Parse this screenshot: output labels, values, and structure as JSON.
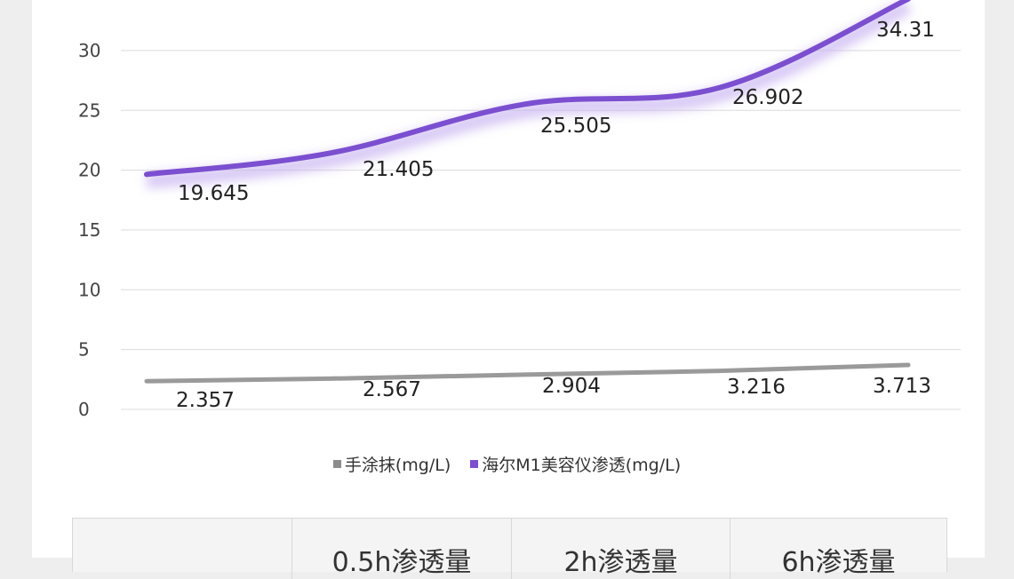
{
  "chart_data": {
    "type": "line",
    "categories": [
      "",
      "",
      "",
      "",
      ""
    ],
    "ylim": [
      0,
      35
    ],
    "yticks": [
      0,
      5,
      10,
      15,
      20,
      25,
      30
    ],
    "grid": true,
    "legend_position": "bottom",
    "series": [
      {
        "name": "手涂抹(mg/L)",
        "color": "#9a9a9a",
        "values": [
          2.357,
          2.567,
          2.904,
          3.216,
          3.713
        ],
        "labels": [
          "2.357",
          "2.567",
          "2.904",
          "3.216",
          "3.713"
        ]
      },
      {
        "name": "海尔M1美容仪渗透(mg/L)",
        "color": "#7b4fd0",
        "values": [
          19.645,
          21.405,
          25.505,
          26.902,
          34.31
        ],
        "labels": [
          "19.645",
          "21.405",
          "25.505",
          "26.902",
          "34.31"
        ]
      }
    ]
  },
  "legend": {
    "item1": "手涂抹(mg/L)",
    "item2": "海尔M1美容仪渗透(mg/L)"
  },
  "table": {
    "headers": [
      "",
      "0.5h渗透量",
      "2h渗透量",
      "6h渗透量"
    ]
  }
}
